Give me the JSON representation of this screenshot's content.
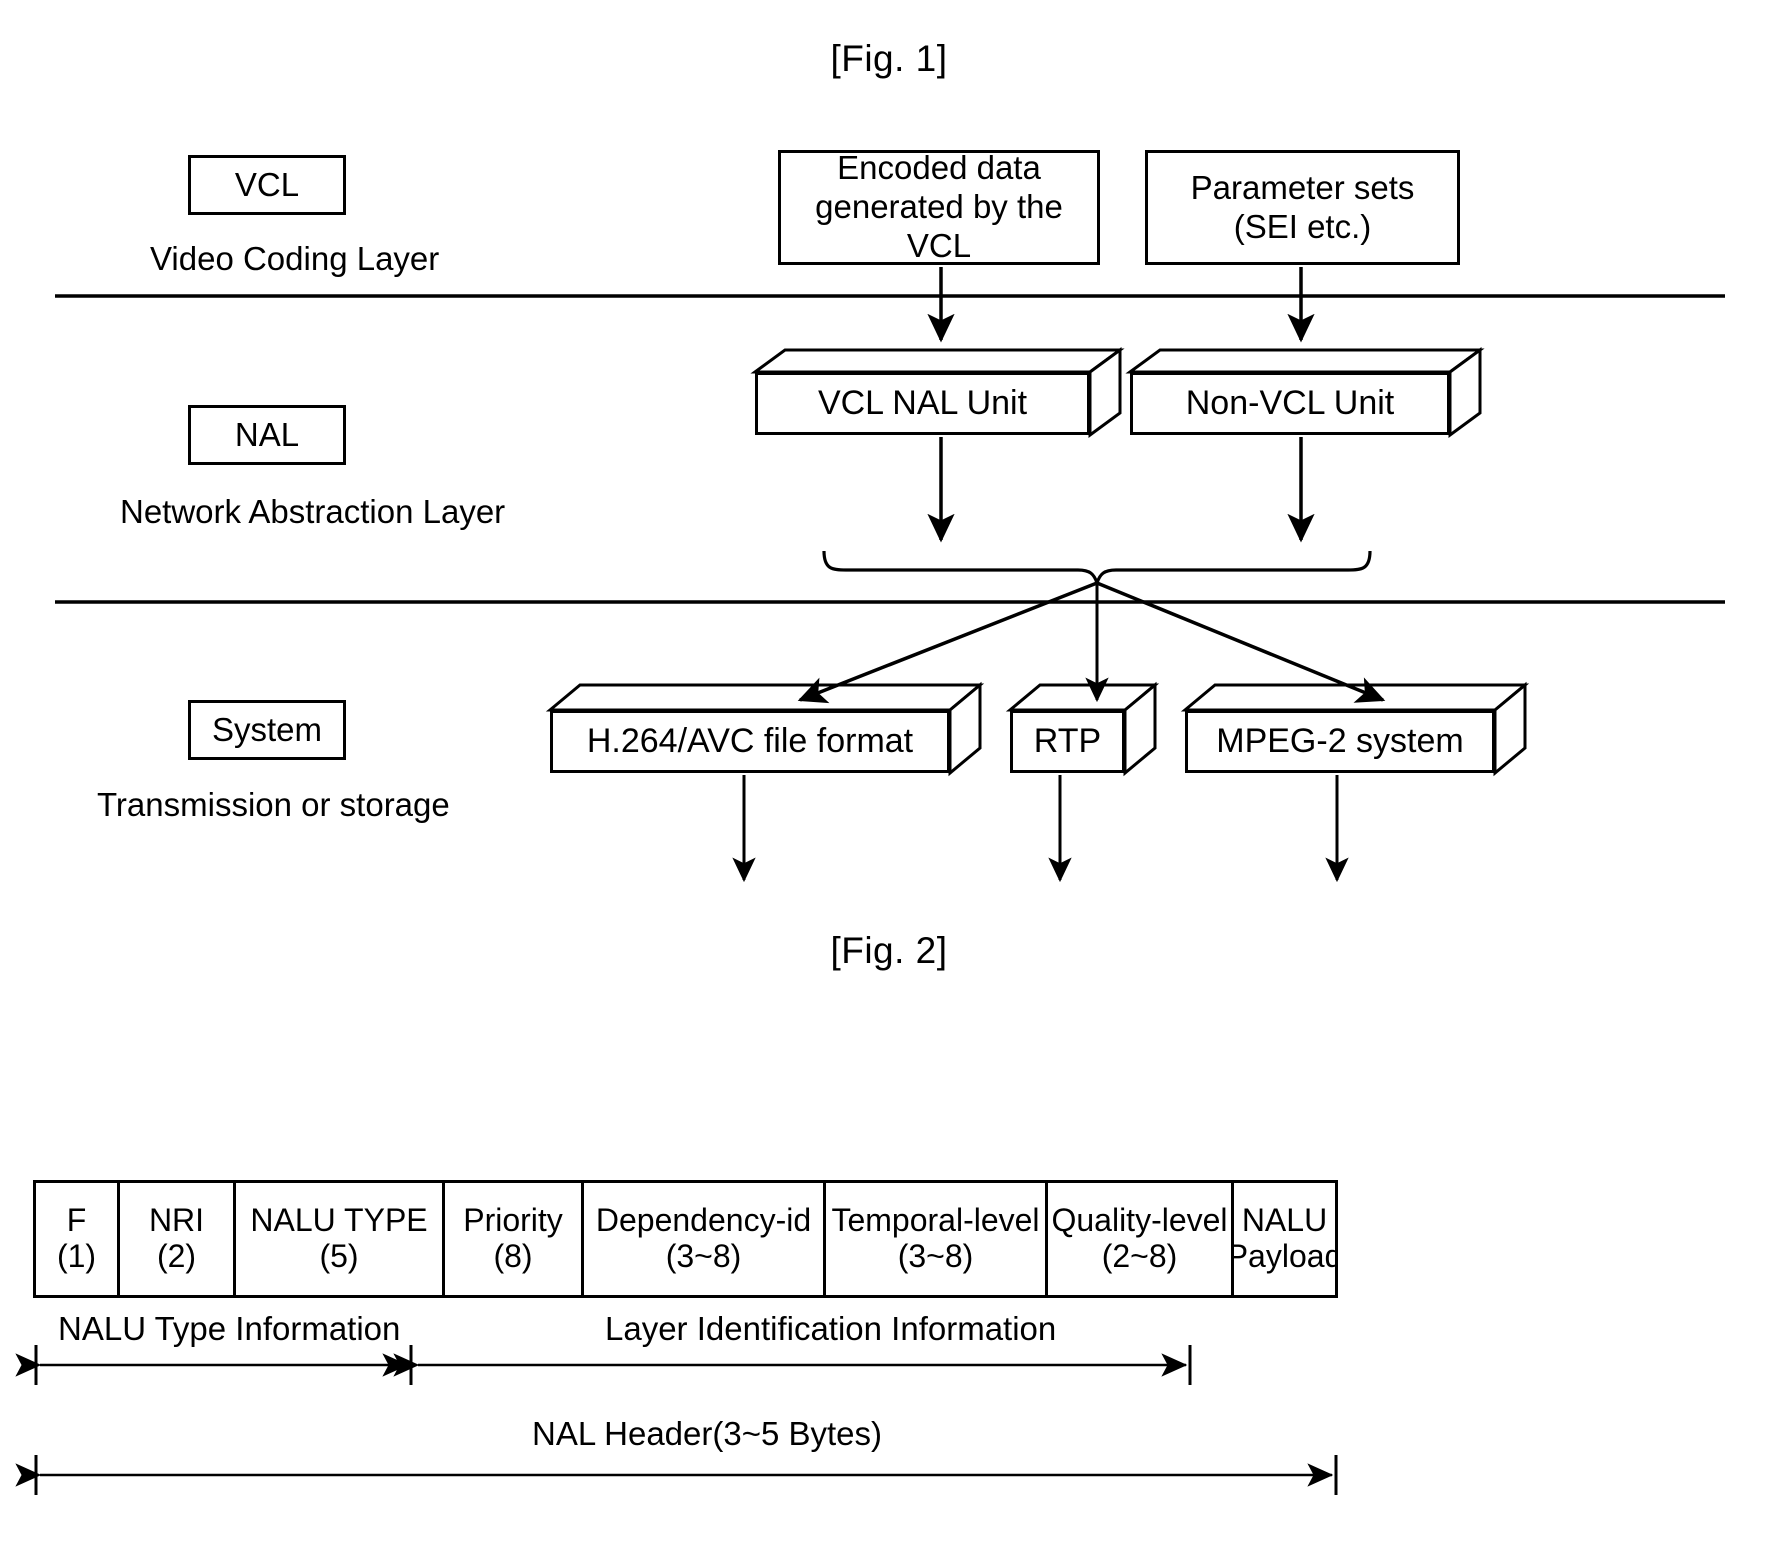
{
  "figures": {
    "fig1_title": "[Fig. 1]",
    "fig2_title": "[Fig. 2]"
  },
  "fig1": {
    "layers": [
      {
        "tag": "VCL",
        "name": "Video Coding Layer"
      },
      {
        "tag": "NAL",
        "name": "Network Abstraction Layer"
      },
      {
        "tag": "System",
        "name": "Transmission or storage"
      }
    ],
    "vcl_boxes": [
      {
        "line1": "Encoded data",
        "line2": "generated by the VCL"
      },
      {
        "line1": "Parameter sets",
        "line2": "(SEI etc.)"
      }
    ],
    "nal_units": [
      {
        "label": "VCL NAL Unit"
      },
      {
        "label": "Non-VCL Unit"
      }
    ],
    "system_blocks": [
      {
        "label": "H.264/AVC file format"
      },
      {
        "label": "RTP"
      },
      {
        "label": "MPEG-2 system"
      }
    ]
  },
  "fig2": {
    "header_fields": [
      {
        "name": "F",
        "bits": "(1)"
      },
      {
        "name": "NRI",
        "bits": "(2)"
      },
      {
        "name": "NALU TYPE",
        "bits": "(5)"
      },
      {
        "name": "Priority",
        "bits": "(8)"
      },
      {
        "name": "Dependency-id",
        "bits": "(3~8)"
      },
      {
        "name": "Temporal-level",
        "bits": "(3~8)"
      },
      {
        "name": "Quality-level",
        "bits": "(2~8)"
      },
      {
        "name": "NALU",
        "bits": "Payload"
      }
    ],
    "annotations": {
      "nalu_type_info": "NALU Type Information",
      "layer_id_info": "Layer Identification Information",
      "nal_header": "NAL Header(3~5 Bytes)"
    }
  },
  "colors": {
    "stroke": "#000000",
    "background": "#ffffff"
  }
}
